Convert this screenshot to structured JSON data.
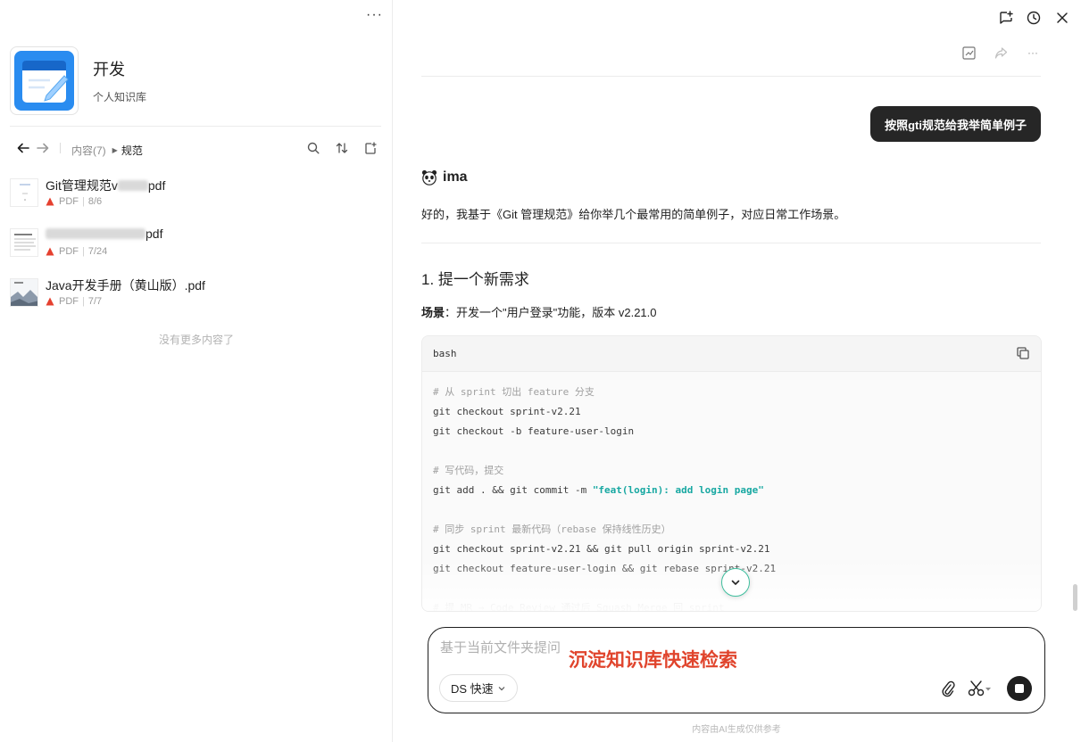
{
  "left": {
    "more_label": "···",
    "kb_title": "开发",
    "kb_subtitle": "个人知识库",
    "breadcrumb": {
      "parent": "内容(7)",
      "current": "规范"
    },
    "files": [
      {
        "name_prefix": "Git管理规范v",
        "name_suffix": "pdf",
        "type": "PDF",
        "date": "8/6"
      },
      {
        "name_prefix": "",
        "name_suffix": "pdf",
        "type": "PDF",
        "date": "7/24"
      },
      {
        "name_prefix": "Java开发手册（黄山版）.pdf",
        "name_suffix": "",
        "type": "PDF",
        "date": "7/7"
      }
    ],
    "no_more": "没有更多内容了"
  },
  "chat": {
    "user_message": "按照gti规范给我举简单例子",
    "ai_name": "ima",
    "ai_intro": "好的，我基于《Git 管理规范》给你举几个最常用的简单例子，对应日常工作场景。",
    "step_heading": "1. 提一个新需求",
    "scene_label": "场景",
    "scene_text": "：开发一个\"用户登录\"功能，版本 v2.21.0",
    "code_lang": "bash",
    "code_lines": {
      "l1": "# 从 sprint 切出 feature 分支",
      "l2": "git checkout sprint-v2.21",
      "l3": "git checkout -b feature-user-login",
      "l4": "# 写代码，提交",
      "l5a": "git add . && git commit -m ",
      "l5b": "\"feat(login): add login page\"",
      "l6": "# 同步 sprint 最新代码（rebase 保持线性历史）",
      "l7": "git checkout sprint-v2.21 && git pull origin sprint-v2.21",
      "l8": "git checkout feature-user-login && git rebase sprint-v2.21",
      "l9": "# 提 MR → Code Review 通过后 Squash Merge 回 sprint"
    }
  },
  "composer": {
    "placeholder": "基于当前文件夹提问",
    "overlay_caption": "沉淀知识库快速检索",
    "model_label": "DS 快速",
    "disclaimer": "内容由AI生成仅供参考"
  },
  "colors": {
    "accent_red": "#e0442c",
    "code_string": "#18a8a2",
    "bubble_bg": "#262626"
  }
}
